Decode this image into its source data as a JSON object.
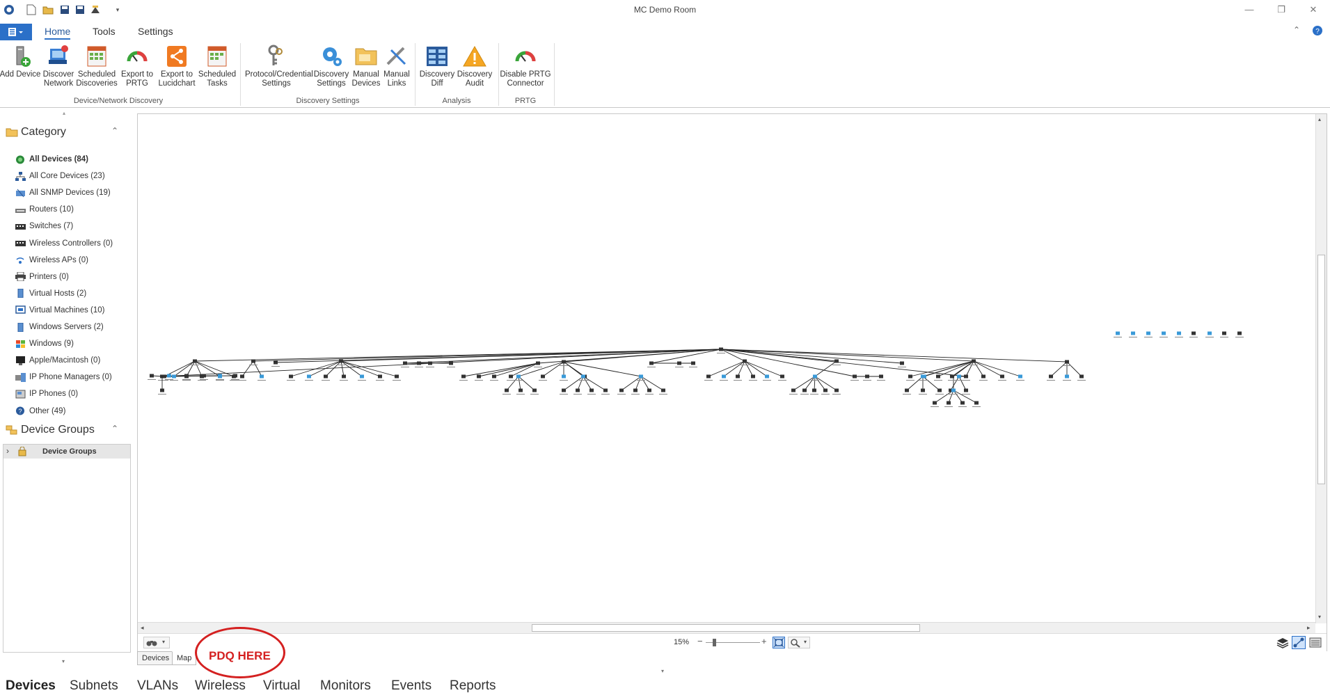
{
  "window": {
    "title": "MC Demo Room"
  },
  "ribbon": {
    "tabs": [
      "Home",
      "Tools",
      "Settings"
    ],
    "active_tab": "Home",
    "groups": [
      {
        "label": "Device/Network Discovery",
        "buttons": [
          {
            "label": "Add Device",
            "icon": "add-device-icon"
          },
          {
            "label": "Discover Network",
            "icon": "discover-network-icon"
          },
          {
            "label": "Scheduled Discoveries",
            "icon": "scheduled-discoveries-icon"
          },
          {
            "label": "Export to PRTG",
            "icon": "gauge-icon"
          },
          {
            "label": "Export to Lucidchart",
            "icon": "lucidchart-icon"
          },
          {
            "label": "Scheduled Tasks",
            "icon": "scheduled-tasks-icon"
          }
        ]
      },
      {
        "label": "Discovery Settings",
        "buttons": [
          {
            "label": "Protocol/Credential Settings",
            "icon": "keys-icon"
          },
          {
            "label": "Discovery Settings",
            "icon": "gear-icon"
          },
          {
            "label": "Manual Devices",
            "icon": "folder-icon"
          },
          {
            "label": "Manual Links",
            "icon": "links-icon"
          }
        ]
      },
      {
        "label": "Analysis",
        "buttons": [
          {
            "label": "Discovery Diff",
            "icon": "diff-icon"
          },
          {
            "label": "Discovery Audit",
            "icon": "warning-icon"
          }
        ]
      },
      {
        "label": "PRTG",
        "buttons": [
          {
            "label": "Disable PRTG Connector",
            "icon": "gauge-icon"
          }
        ]
      }
    ]
  },
  "category": {
    "title": "Category",
    "items": [
      {
        "label": "All Devices (84)",
        "icon": "globe-icon",
        "selected": true
      },
      {
        "label": "All Core Devices (23)",
        "icon": "network-icon"
      },
      {
        "label": "All SNMP Devices (19)",
        "icon": "snmp-icon"
      },
      {
        "label": "Routers (10)",
        "icon": "router-icon"
      },
      {
        "label": "Switches (7)",
        "icon": "switch-icon"
      },
      {
        "label": "Wireless Controllers (0)",
        "icon": "switch-icon"
      },
      {
        "label": "Wireless APs (0)",
        "icon": "wireless-icon"
      },
      {
        "label": "Printers (0)",
        "icon": "printer-icon"
      },
      {
        "label": "Virtual Hosts (2)",
        "icon": "server-icon"
      },
      {
        "label": "Virtual Machines (10)",
        "icon": "vm-icon"
      },
      {
        "label": "Windows Servers (2)",
        "icon": "server-icon"
      },
      {
        "label": "Windows (9)",
        "icon": "windows-icon"
      },
      {
        "label": "Apple/Macintosh (0)",
        "icon": "apple-icon"
      },
      {
        "label": "IP Phone Managers (0)",
        "icon": "phone-manager-icon"
      },
      {
        "label": "IP Phones (0)",
        "icon": "phone-icon"
      },
      {
        "label": "Other (49)",
        "icon": "question-icon"
      }
    ]
  },
  "device_groups": {
    "title": "Device Groups",
    "tree_item": "Device Groups"
  },
  "map": {
    "zoom_label": "15%",
    "zoom_level": 0.15
  },
  "subtabs": [
    "Devices",
    "Map"
  ],
  "annotation": {
    "text": "PDQ HERE"
  },
  "bottom_tabs": [
    "Devices",
    "Subnets",
    "VLANs",
    "Wireless",
    "Virtual",
    "Monitors",
    "Events",
    "Reports"
  ],
  "colors": {
    "accent": "#2b70c8",
    "annotation": "#d42020"
  }
}
